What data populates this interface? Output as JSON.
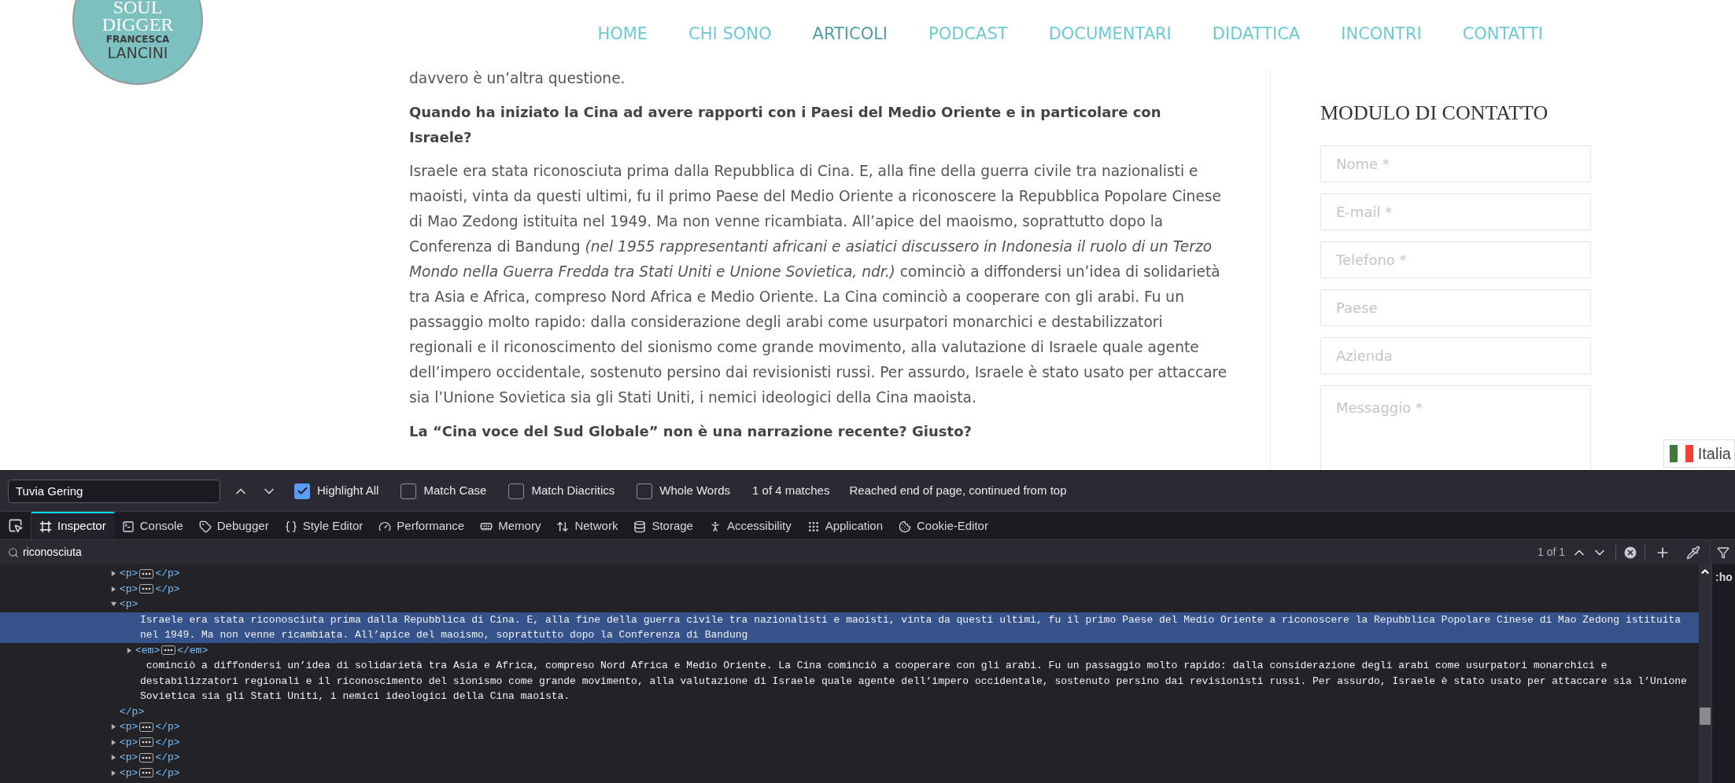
{
  "site": {
    "logo": [
      "SOUL",
      "DIGGER",
      "FRANCESCA",
      "LANCINI"
    ],
    "nav": [
      {
        "label": "HOME",
        "selected": false
      },
      {
        "label": "CHI SONO",
        "selected": false
      },
      {
        "label": "ARTICOLI",
        "selected": true
      },
      {
        "label": "PODCAST",
        "selected": false
      },
      {
        "label": "DOCUMENTARI",
        "selected": false
      },
      {
        "label": "DIDATTICA",
        "selected": false
      },
      {
        "label": "INCONTRI",
        "selected": false
      },
      {
        "label": "CONTATTI",
        "selected": false
      }
    ]
  },
  "article": [
    {
      "kind": "paragraph",
      "text": "davvero è un’altra questione."
    },
    {
      "kind": "heading",
      "text": "Quando ha iniziato la Cina ad avere rapporti con i Paesi del Medio Oriente e in particolare con Israele?"
    },
    {
      "kind": "paragraph",
      "text": "Israele era stata riconosciuta prima dalla Repubblica di Cina. E, alla fine della guerra civile tra nazionalisti e maoisti, vinta da questi ultimi, fu il primo Paese del Medio Oriente a riconoscere la Repubblica Popolare Cinese di Mao Zedong istituita nel 1949. Ma non venne ricambiata. All’apice del maoismo, soprattutto dopo la Conferenza di Bandung *(nel 1955 rappresentanti africani e asiatici discussero in Indonesia il ruolo di un Terzo Mondo nella Guerra Fredda tra Stati Uniti e Unione Sovietica, ndr.)* cominciò a diffondersi un’idea di solidarietà tra Asia e Africa, compreso Nord Africa e Medio Oriente. La Cina cominciò a cooperare con gli arabi. Fu un passaggio molto rapido: dalla considerazione degli arabi come usurpatori monarchici e destabilizzatori regionali e il riconoscimento del sionismo come grande movimento, alla valutazione di Israele quale agente dell’impero occidentale, sostenuto persino dai revisionisti russi. Per assurdo, Israele è stato usato per attaccare sia l’Unione Sovietica sia gli Stati Uniti, i nemici ideologici della Cina maoista."
    },
    {
      "kind": "heading",
      "text": "La “Cina voce del Sud Globale” non è una narrazione recente? Giusto?"
    }
  ],
  "sidebar": {
    "title": "MODULO DI CONTATTO",
    "fields": [
      {
        "kind": "input",
        "placeholder": "Nome *"
      },
      {
        "kind": "input",
        "placeholder": "E-mail *"
      },
      {
        "kind": "input",
        "placeholder": "Telefono *"
      },
      {
        "kind": "input",
        "placeholder": "Paese"
      },
      {
        "kind": "input",
        "placeholder": "Azienda"
      },
      {
        "kind": "textarea",
        "placeholder": "Messaggio *"
      }
    ]
  },
  "language_badge": {
    "label": "Italia"
  },
  "find_bar": {
    "query": "Tuvia Gering",
    "options": [
      {
        "label": "Highlight All",
        "checked": true
      },
      {
        "label": "Match Case",
        "checked": false
      },
      {
        "label": "Match Diacritics",
        "checked": false
      },
      {
        "label": "Whole Words",
        "checked": false
      }
    ],
    "count": "1 of 4 matches",
    "status": "Reached end of page, continued from top"
  },
  "devtools": {
    "tabs": [
      {
        "label": "Inspector",
        "selected": true
      },
      {
        "label": "Console",
        "selected": false
      },
      {
        "label": "Debugger",
        "selected": false
      },
      {
        "label": "Style Editor",
        "selected": false
      },
      {
        "label": "Performance",
        "selected": false
      },
      {
        "label": "Memory",
        "selected": false
      },
      {
        "label": "Network",
        "selected": false
      },
      {
        "label": "Storage",
        "selected": false
      },
      {
        "label": "Accessibility",
        "selected": false
      },
      {
        "label": "Application",
        "selected": false
      },
      {
        "label": "Cookie-Editor",
        "selected": false
      }
    ],
    "search": {
      "value": "riconosciuta",
      "count": "1 of 1"
    },
    "nodes": [
      {
        "kind": "element",
        "open": "<p>",
        "close": "</p>",
        "expanded": false
      },
      {
        "kind": "element",
        "open": "<p>",
        "close": "</p>",
        "expanded": false
      },
      {
        "kind": "element",
        "open": "<p>",
        "close": "</p>",
        "expanded": true,
        "children": [
          {
            "kind": "text",
            "selected": true,
            "text": "Israele era stata riconosciuta prima dalla Repubblica di Cina. E, alla fine della guerra civile tra nazionalisti e maoisti, vinta da questi ultimi, fu il primo Paese del Medio Oriente a riconoscere la Repubblica Popolare Cinese di Mao Zedong istituita nel 1949. Ma non venne ricambiata. All’apice del maoismo, soprattutto dopo la Conferenza di Bandung"
          },
          {
            "kind": "element",
            "open": "<em>",
            "close": "</em>",
            "expanded": false
          },
          {
            "kind": "text",
            "selected": false,
            "text": " cominciò a diffondersi un’idea di solidarietà tra Asia e Africa, compreso Nord Africa e Medio Oriente. La Cina cominciò a cooperare con gli arabi. Fu un passaggio molto rapido: dalla considerazione degli arabi come usurpatori monarchici e destabilizzatori regionali e il riconoscimento del sionismo come grande movimento, alla valutazione di Israele quale agente dell’impero occidentale, sostenuto persino dai revisionisti russi. Per assurdo, Israele è stato usato per attaccare sia l’Unione Sovietica sia gli Stati Uniti, i nemici ideologici della Cina maoista."
          }
        ]
      },
      {
        "kind": "element",
        "open": "<p>",
        "close": "</p>",
        "expanded": false
      },
      {
        "kind": "element",
        "open": "<p>",
        "close": "</p>",
        "expanded": false
      },
      {
        "kind": "element",
        "open": "<p>",
        "close": "</p>",
        "expanded": false
      },
      {
        "kind": "element",
        "open": "<p>",
        "close": "</p>",
        "expanded": false
      }
    ],
    "side_panel_text": ":ho"
  }
}
